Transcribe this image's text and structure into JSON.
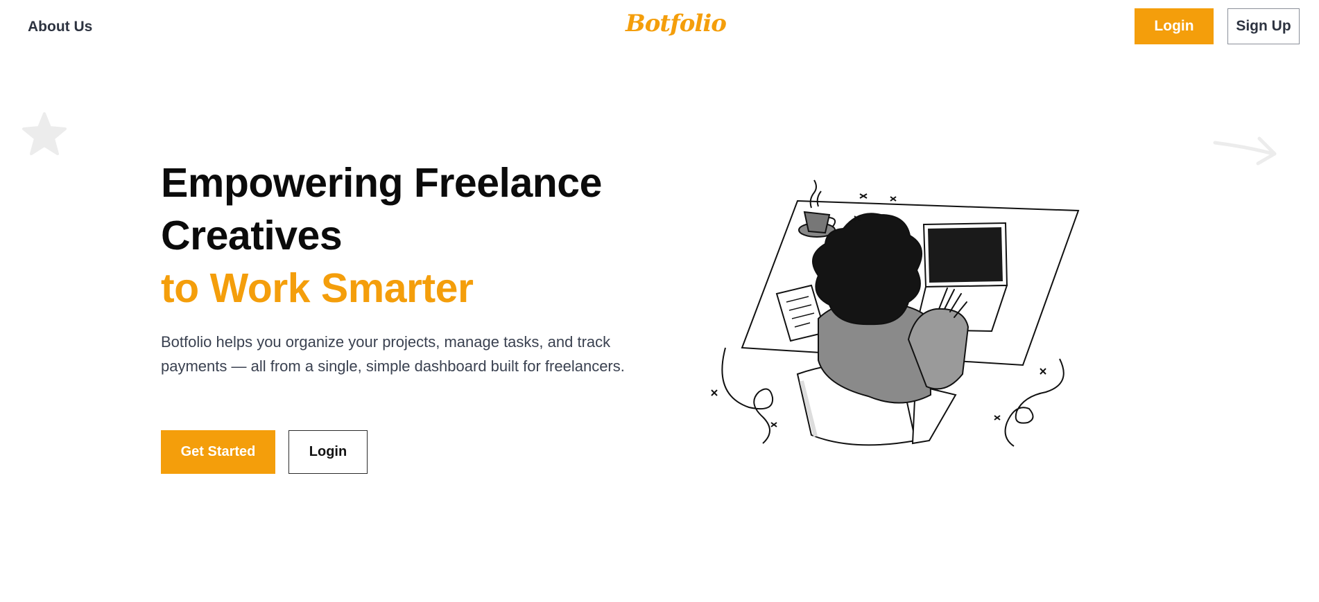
{
  "header": {
    "about_label": "About Us",
    "logo_text": "Botfolio",
    "login_label": "Login",
    "signup_label": "Sign Up"
  },
  "hero": {
    "title_line1": "Empowering Freelance",
    "title_line2": "Creatives",
    "title_accent": "to Work Smarter",
    "description": "Botfolio helps you organize your projects, manage tasks, and track payments — all from a single, simple dashboard built for freelancers.",
    "primary_cta": "Get Started",
    "secondary_cta": "Login"
  },
  "colors": {
    "accent": "#f49e0b",
    "text_dark": "#0b0b0b",
    "text_muted": "#3a4150",
    "decoration": "#ececec"
  },
  "icons": {
    "star": "star-icon",
    "arrow": "arrow-right-icon"
  }
}
